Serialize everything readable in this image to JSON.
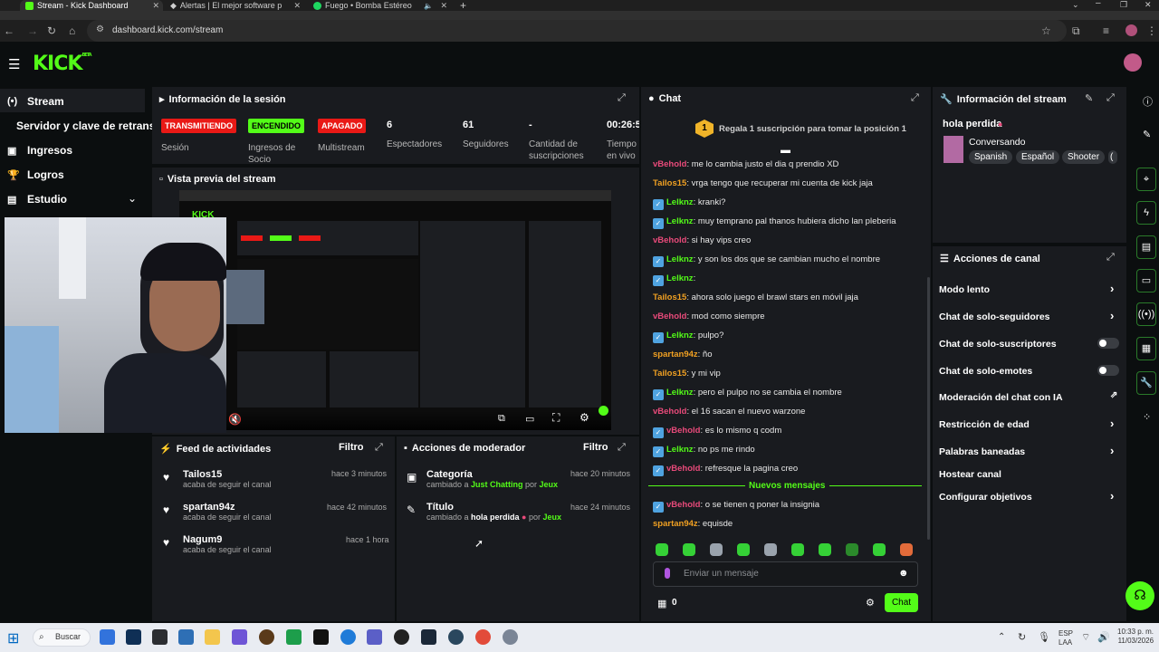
{
  "browser": {
    "tabs": [
      {
        "title": "Stream - Kick Dashboard",
        "active": true
      },
      {
        "title": "Alertas | El mejor software para",
        "active": false
      },
      {
        "title": "Fuego • Bomba Estéreo",
        "active": false
      }
    ],
    "url": "dashboard.kick.com/stream"
  },
  "header": {
    "logo": "KICK",
    "logo_tag": "BETA"
  },
  "sidebar": {
    "items": [
      {
        "label": "Stream",
        "icon": "broadcast-icon"
      },
      {
        "label": "Servidor y clave de retransm",
        "icon": ""
      },
      {
        "label": "Ingresos",
        "icon": "cash-icon"
      },
      {
        "label": "Logros",
        "icon": "trophy-icon"
      },
      {
        "label": "Estudio",
        "icon": "studio-icon"
      }
    ]
  },
  "session": {
    "title": "Información de la sesión",
    "stats": [
      {
        "value": "TRANSMITIENDO",
        "label": "Sesión",
        "color": "#e91916"
      },
      {
        "value": "ENCENDIDO",
        "label": "Ingresos de Socio",
        "color": "#53fc18"
      },
      {
        "value": "APAGADO",
        "label": "Multistream",
        "color": "#e91916"
      },
      {
        "value": "6",
        "label": "Espectadores"
      },
      {
        "value": "61",
        "label": "Seguidores"
      },
      {
        "value": "-",
        "label": "Cantidad de suscripciones"
      },
      {
        "value": "00:26:5",
        "label": "Tiempo en vivo"
      }
    ]
  },
  "preview": {
    "title": "Vista previa del stream"
  },
  "activity": {
    "title": "Feed de actividades",
    "filter": "Filtro",
    "items": [
      {
        "name": "Tailos15",
        "sub": "acaba de seguir el canal",
        "time": "hace 3 minutos"
      },
      {
        "name": "spartan94z",
        "sub": "acaba de seguir el canal",
        "time": "hace 42 minutos"
      },
      {
        "name": "Nagum9",
        "sub": "acaba de seguir el canal",
        "time": "hace 1 hora"
      }
    ]
  },
  "modactions": {
    "title": "Acciones de moderador",
    "filter": "Filtro",
    "items": [
      {
        "name": "Categoría",
        "pre": "cambiado a ",
        "value": "Just Chatting",
        "by": " por ",
        "who": "Jeux",
        "time": "hace 20 minutos"
      },
      {
        "name": "Título",
        "pre": "cambiado a ",
        "value": "hola perdida",
        "by": " por ",
        "who": "Jeux",
        "time": "hace 24 minutos"
      }
    ]
  },
  "chat": {
    "title": "Chat",
    "gift_text": "Regala 1 suscripción para tomar la posición 1",
    "gift_rank": "1",
    "new_messages": "Nuevos mensajes",
    "input_placeholder": "Enviar un mensaje",
    "send_label": "Chat",
    "points": "0",
    "messages": [
      {
        "user": "vBehold",
        "color": "#e84a7a",
        "badge": false,
        "text": ": me lo cambia justo el dia q prendio XD"
      },
      {
        "user": "Tailos15",
        "color": "#f0a022",
        "badge": false,
        "text": ": vrga tengo que recuperar mi cuenta de kick jaja"
      },
      {
        "user": "Lelknz",
        "color": "#53fc18",
        "badge": true,
        "text": ": kranki?"
      },
      {
        "user": "Lelknz",
        "color": "#53fc18",
        "badge": true,
        "text": ": muy temprano pal thanos hubiera dicho lan pleberia"
      },
      {
        "user": "vBehold",
        "color": "#e84a7a",
        "badge": false,
        "text": ": si hay vips creo"
      },
      {
        "user": "Lelknz",
        "color": "#53fc18",
        "badge": true,
        "text": ": y son los dos que se cambian mucho el nombre"
      },
      {
        "user": "Lelknz",
        "color": "#53fc18",
        "badge": true,
        "text": ": "
      },
      {
        "user": "Tailos15",
        "color": "#f0a022",
        "badge": false,
        "text": ": ahora solo juego el brawl stars en móvil jaja"
      },
      {
        "user": "vBehold",
        "color": "#e84a7a",
        "badge": false,
        "text": ": mod como siempre"
      },
      {
        "user": "Lelknz",
        "color": "#53fc18",
        "badge": true,
        "text": ": pulpo?"
      },
      {
        "user": "spartan94z",
        "color": "#f0a022",
        "badge": false,
        "text": ": ño"
      },
      {
        "user": "Tailos15",
        "color": "#f0a022",
        "badge": false,
        "text": ": y mi vip"
      },
      {
        "user": "Lelknz",
        "color": "#53fc18",
        "badge": true,
        "text": ": pero el pulpo no se cambia el nombre"
      },
      {
        "user": "vBehold",
        "color": "#e84a7a",
        "badge": false,
        "text": ": el 16 sacan el nuevo warzone"
      },
      {
        "user": "vBehold",
        "color": "#e84a7a",
        "badge": true,
        "text": ": es lo mismo q codm"
      },
      {
        "user": "Lelknz",
        "color": "#53fc18",
        "badge": true,
        "text": ": no ps me rindo"
      },
      {
        "user": "vBehold",
        "color": "#e84a7a",
        "badge": true,
        "text": ": refresque la pagina creo"
      }
    ],
    "new_after": [
      {
        "user": "vBehold",
        "color": "#e84a7a",
        "badge": true,
        "text": ": o se tienen q poner la insignia"
      },
      {
        "user": "spartan94z",
        "color": "#f0a022",
        "badge": false,
        "text": ": equisde"
      }
    ]
  },
  "streaminfo": {
    "title": "Información del stream",
    "stream_title": "hola perdida",
    "category": "Conversando",
    "tags": [
      "Spanish",
      "Español",
      "Shooter"
    ]
  },
  "channel_actions": {
    "title": "Acciones de canal",
    "items": [
      {
        "label": "Modo lento",
        "control": "chevron"
      },
      {
        "label": "Chat de solo-seguidores",
        "control": "chevron"
      },
      {
        "label": "Chat de solo-suscriptores",
        "control": "toggle"
      },
      {
        "label": "Chat de solo-emotes",
        "control": "toggle"
      },
      {
        "label": "Moderación del chat con IA",
        "control": "external"
      },
      {
        "label": "Restricción de edad",
        "control": "chevron"
      },
      {
        "label": "Palabras baneadas",
        "control": "chevron"
      },
      {
        "label": "Hostear canal",
        "control": "none"
      },
      {
        "label": "Configurar objetivos",
        "control": "chevron"
      }
    ]
  },
  "taskbar": {
    "search": "Buscar",
    "lang": "ESP",
    "lang2": "LAA",
    "time": "10:33 p. m.",
    "date": "11/03/2026"
  },
  "colors": {
    "kick_green": "#53fc18",
    "live_red": "#e91916",
    "panel": "#191b1f",
    "bg": "#0b0e0f"
  }
}
